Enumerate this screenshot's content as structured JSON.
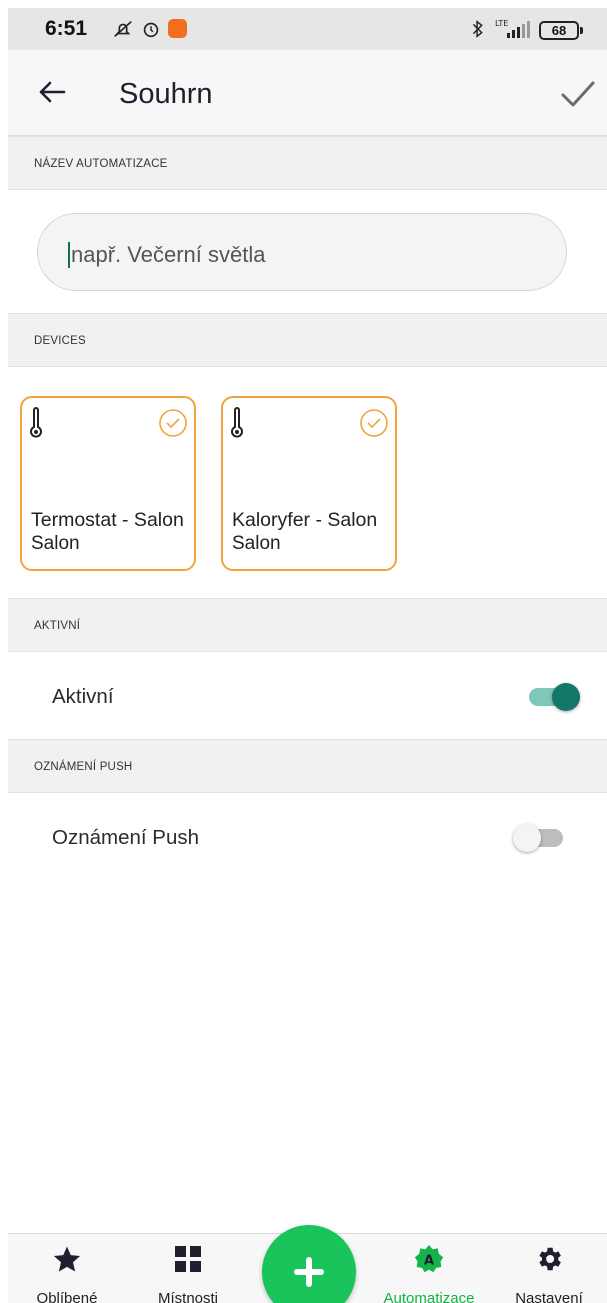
{
  "status_bar": {
    "time": "6:51",
    "battery": "68",
    "icons": [
      "notifications-off-icon",
      "alarm-icon",
      "app-notification-icon",
      "bluetooth-icon",
      "lte-signal-icon",
      "battery-icon"
    ]
  },
  "app_bar": {
    "title": "Souhrn",
    "back_icon": "arrow-left-icon",
    "confirm_icon": "check-icon"
  },
  "sections": {
    "name": "NÁZEV AUTOMATIZACE",
    "devices": "DEVICES",
    "active": "AKTIVNÍ",
    "push": "OZNÁMENÍ PUSH"
  },
  "name_input": {
    "value": "",
    "placeholder": "např. Večerní světla"
  },
  "devices": [
    {
      "name": "Termostat - Salon",
      "room": "Salon",
      "icon": "thermometer-icon",
      "selected": true
    },
    {
      "name": "Kaloryfer - Salon",
      "room": "Salon",
      "icon": "thermometer-icon",
      "selected": true
    }
  ],
  "rows": {
    "active": {
      "label": "Aktivní",
      "on": true
    },
    "push": {
      "label": "Oznámení Push",
      "on": false
    }
  },
  "bottom_nav": [
    {
      "label": "Oblíbené",
      "icon": "star-icon"
    },
    {
      "label": "Místnosti",
      "icon": "grid-icon"
    },
    {
      "label": "Automatizace",
      "icon": "automation-badge-icon",
      "active": true
    },
    {
      "label": "Nastavení",
      "icon": "gear-icon"
    }
  ],
  "fab": {
    "icon": "plus-icon"
  },
  "colors": {
    "accent_green": "#19c55a",
    "toggle_on": "#11786a",
    "card_border": "#f2a43c",
    "nav_active": "#12b348"
  }
}
